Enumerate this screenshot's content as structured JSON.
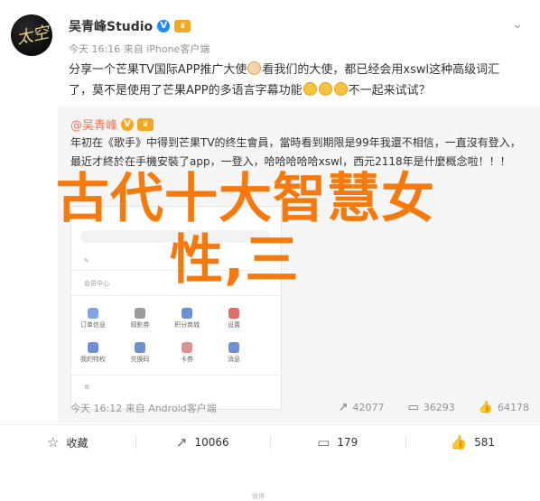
{
  "author": {
    "name": "吴青峰Studio",
    "meta": "今天 16:16 来自 iPhone客户端",
    "avatar_text": "太空"
  },
  "post_text": [
    "分享一个芒果TV国际APP推广大使",
    "看我们的大使，都已经会用xswl这种高级词汇了，莫不是使用了芒果APP的多语言字幕功能",
    "不一起来试试？"
  ],
  "repost": {
    "author": "@吴青峰",
    "text": "年初在《歌手》中得到芒果TV的终生會員，當時看到期限是99年我還不相信，一直沒有登入，最近才終於在手機安裝了app，一登入，哈哈哈哈哈xswl，西元2118年是什麼概念啦！！！",
    "meta": "今天 16:12 来自 Android客户端",
    "stats": {
      "reposts": "42077",
      "comments": "36293",
      "likes": "64178"
    },
    "phone": {
      "top_label": "会员中心",
      "items": [
        "订单信息",
        "观影券",
        "积分商城",
        "设置",
        "我的特权",
        "兑换码",
        "卡券",
        "消息"
      ],
      "watermark": "微博"
    }
  },
  "overlay": {
    "line1": "古代十大智慧女",
    "line2": "性,三"
  },
  "footer": {
    "favorite": "收藏",
    "repost": "10066",
    "comment": "179",
    "like": "581"
  },
  "colors": {
    "accent": "#f47a10",
    "link": "#eb7350",
    "verified": "#1a8cff"
  }
}
